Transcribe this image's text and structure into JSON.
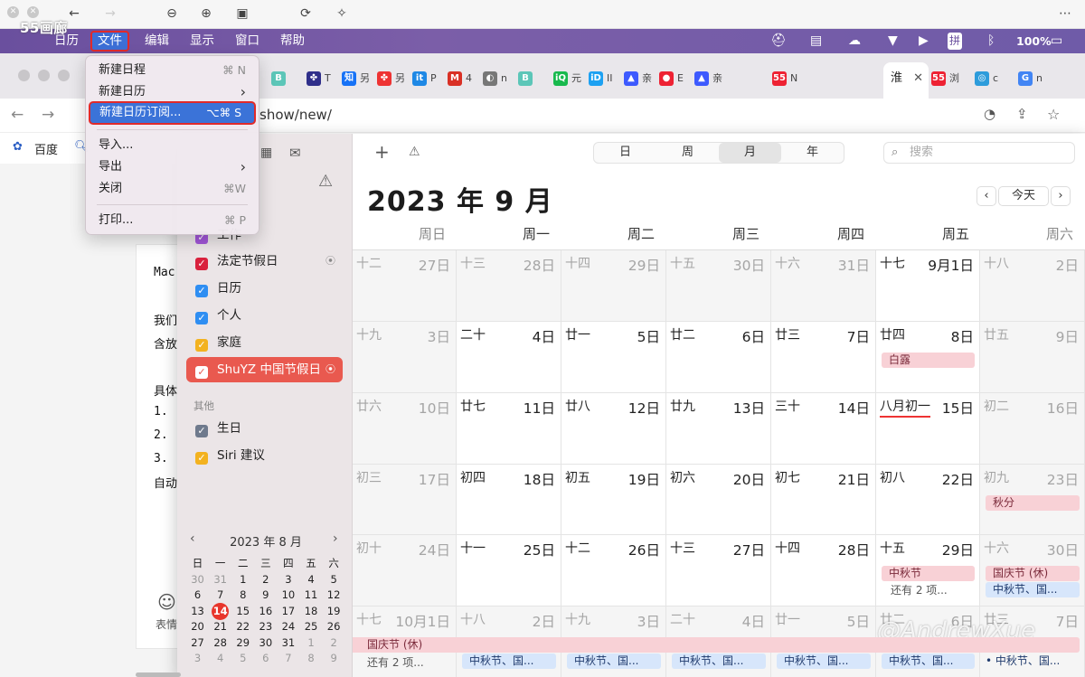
{
  "viewer": {
    "watermark_top": "55画廊"
  },
  "menubar": {
    "apple": "",
    "items": [
      "日历",
      "文件",
      "编辑",
      "显示",
      "窗口",
      "帮助"
    ],
    "battery": "100%",
    "input_method": "拼"
  },
  "browser": {
    "address": "show/new/",
    "bookmarks": [
      "百度"
    ],
    "tab_active_label": "淮",
    "tabs": [
      {
        "icon": "B",
        "label": "",
        "color": "#5cc6b8"
      },
      {
        "icon": "✤",
        "label": "T",
        "color": "#2f2f8a"
      },
      {
        "icon": "知",
        "label": "另",
        "color": "#1772f6"
      },
      {
        "icon": "✤",
        "label": "另",
        "color": "#e33"
      },
      {
        "icon": "it",
        "label": "P",
        "color": "#1e88e5"
      },
      {
        "icon": "M",
        "label": "4",
        "color": "#d93025"
      },
      {
        "icon": "◐",
        "label": "n",
        "color": "#777"
      },
      {
        "icon": "B",
        "label": "",
        "color": "#5cc6b8"
      },
      {
        "icon": "iQ",
        "label": "元",
        "color": "#18b94d"
      },
      {
        "icon": "iD",
        "label": "II",
        "color": "#1da1f2"
      },
      {
        "icon": "▲",
        "label": "亲",
        "color": "#3d5afe"
      },
      {
        "icon": "●",
        "label": "E",
        "color": "#e23"
      },
      {
        "icon": "▲",
        "label": "亲",
        "color": "#3d5afe"
      },
      {
        "icon": "55",
        "label": "N",
        "color": "#e23"
      },
      {
        "icon": "55",
        "label": "浏",
        "color": "#e23"
      },
      {
        "icon": "◎",
        "label": "c",
        "color": "#2d9cdb"
      },
      {
        "icon": "G",
        "label": "n",
        "color": "#4285f4"
      }
    ]
  },
  "page": {
    "lines": [
      "Mac",
      "我们",
      "含放",
      "具体",
      "1.",
      "2.",
      "3.",
      "自动"
    ],
    "emoji_label": "表情"
  },
  "file_menu": {
    "items": [
      {
        "label": "新建日程",
        "shortcut": "⌘ N"
      },
      {
        "label": "新建日历",
        "shortcut": "›"
      },
      {
        "label": "新建日历订阅...",
        "shortcut": "⌥⌘ S",
        "highlighted": true
      },
      {
        "label": "导入...",
        "shortcut": ""
      },
      {
        "label": "导出",
        "shortcut": "›"
      },
      {
        "label": "关闭",
        "shortcut": "⌘W"
      },
      {
        "label": "打印...",
        "shortcut": "⌘ P"
      }
    ]
  },
  "sidebar": {
    "calendars": [
      {
        "label": "工作",
        "color": "#a256d8"
      },
      {
        "label": "法定节假日",
        "color": "#d9213d",
        "broadcast": true
      },
      {
        "label": "日历",
        "color": "#2f8ef2"
      },
      {
        "label": "个人",
        "color": "#2f8ef2"
      },
      {
        "label": "家庭",
        "color": "#f3b21f"
      },
      {
        "label": "ShuYZ 中国节假日",
        "color": "#e9594f",
        "selected": true,
        "broadcast": true
      }
    ],
    "other_header": "其他",
    "others": [
      {
        "label": "生日",
        "color": "#6f7a8d"
      },
      {
        "label": "Siri 建议",
        "color": "#f3b21f"
      }
    ]
  },
  "mini_cal": {
    "title": "2023 年 8 月",
    "weekdays": [
      "日",
      "一",
      "二",
      "三",
      "四",
      "五",
      "六"
    ],
    "weeks": [
      [
        "30",
        "31",
        "1",
        "2",
        "3",
        "4",
        "5"
      ],
      [
        "6",
        "7",
        "8",
        "9",
        "10",
        "11",
        "12"
      ],
      [
        "13",
        "14",
        "15",
        "16",
        "17",
        "18",
        "19"
      ],
      [
        "20",
        "21",
        "22",
        "23",
        "24",
        "25",
        "26"
      ],
      [
        "27",
        "28",
        "29",
        "30",
        "31",
        "1",
        "2"
      ],
      [
        "3",
        "4",
        "5",
        "6",
        "7",
        "8",
        "9"
      ]
    ],
    "today": "14"
  },
  "toolbar": {
    "add": "+",
    "views": [
      "日",
      "周",
      "月",
      "年"
    ],
    "active_view": "月",
    "search_placeholder": "搜索",
    "today": "今天"
  },
  "calendar": {
    "title": "2023 年 9 月",
    "weekdays": [
      "周日",
      "周一",
      "周二",
      "周三",
      "周四",
      "周五",
      "周六"
    ],
    "weeks": [
      [
        {
          "lunar": "十二",
          "day": "27日",
          "grey": true
        },
        {
          "lunar": "十三",
          "day": "28日",
          "grey": true
        },
        {
          "lunar": "十四",
          "day": "29日",
          "grey": true
        },
        {
          "lunar": "十五",
          "day": "30日",
          "grey": true
        },
        {
          "lunar": "十六",
          "day": "31日",
          "grey": true
        },
        {
          "lunar": "十七",
          "day": "9月1日"
        },
        {
          "lunar": "十八",
          "day": "2日",
          "grey": true
        }
      ],
      [
        {
          "lunar": "十九",
          "day": "3日",
          "grey": true
        },
        {
          "lunar": "二十",
          "day": "4日"
        },
        {
          "lunar": "廿一",
          "day": "5日"
        },
        {
          "lunar": "廿二",
          "day": "6日"
        },
        {
          "lunar": "廿三",
          "day": "7日"
        },
        {
          "lunar": "廿四",
          "day": "8日",
          "events": [
            {
              "label": "白露",
              "color": "pink"
            }
          ]
        },
        {
          "lunar": "廿五",
          "day": "9日",
          "grey": true
        }
      ],
      [
        {
          "lunar": "廿六",
          "day": "10日",
          "grey": true
        },
        {
          "lunar": "廿七",
          "day": "11日"
        },
        {
          "lunar": "廿八",
          "day": "12日"
        },
        {
          "lunar": "廿九",
          "day": "13日"
        },
        {
          "lunar": "三十",
          "day": "14日"
        },
        {
          "lunar": "八月初一",
          "day": "15日",
          "underline": true
        },
        {
          "lunar": "初二",
          "day": "16日",
          "grey": true
        }
      ],
      [
        {
          "lunar": "初三",
          "day": "17日",
          "grey": true
        },
        {
          "lunar": "初四",
          "day": "18日"
        },
        {
          "lunar": "初五",
          "day": "19日"
        },
        {
          "lunar": "初六",
          "day": "20日"
        },
        {
          "lunar": "初七",
          "day": "21日"
        },
        {
          "lunar": "初八",
          "day": "22日"
        },
        {
          "lunar": "初九",
          "day": "23日",
          "grey": true,
          "events": [
            {
              "label": "秋分",
              "color": "pink"
            }
          ]
        }
      ],
      [
        {
          "lunar": "初十",
          "day": "24日",
          "grey": true
        },
        {
          "lunar": "十一",
          "day": "25日"
        },
        {
          "lunar": "十二",
          "day": "26日"
        },
        {
          "lunar": "十三",
          "day": "27日"
        },
        {
          "lunar": "十四",
          "day": "28日"
        },
        {
          "lunar": "十五",
          "day": "29日",
          "events": [
            {
              "label": "中秋节",
              "color": "pink"
            }
          ],
          "more": "还有 2 项..."
        },
        {
          "lunar": "十六",
          "day": "30日",
          "grey": true,
          "events": [
            {
              "label": "国庆节 (休)",
              "color": "pink"
            },
            {
              "label": "中秋节、国...",
              "color": "blue"
            }
          ]
        }
      ],
      [
        {
          "lunar": "十七",
          "day": "10月1日",
          "grey": true,
          "events": [
            {
              "label": "国庆节 (休)",
              "color": "pink",
              "span": true
            }
          ],
          "more": "还有 2 项..."
        },
        {
          "lunar": "十八",
          "day": "2日",
          "grey": true,
          "events": [
            {
              "label": "中秋节、国...",
              "color": "blue",
              "row": 2
            }
          ]
        },
        {
          "lunar": "十九",
          "day": "3日",
          "grey": true,
          "events": [
            {
              "label": "中秋节、国...",
              "color": "blue",
              "row": 2
            }
          ]
        },
        {
          "lunar": "二十",
          "day": "4日",
          "grey": true,
          "events": [
            {
              "label": "中秋节、国...",
              "color": "blue",
              "row": 2
            }
          ]
        },
        {
          "lunar": "廿一",
          "day": "5日",
          "grey": true,
          "events": [
            {
              "label": "中秋节、国...",
              "color": "blue",
              "row": 2
            }
          ]
        },
        {
          "lunar": "廿二",
          "day": "6日",
          "grey": true,
          "events": [
            {
              "label": "中秋节、国...",
              "color": "blue",
              "row": 2
            }
          ]
        },
        {
          "lunar": "廿三",
          "day": "7日",
          "grey": true,
          "events": [
            {
              "label": "国庆节 (班)",
              "color": "pink"
            },
            {
              "label": "中秋节、国...",
              "color": "blue",
              "dot": true
            }
          ]
        }
      ]
    ]
  },
  "watermark": "@AndrewXue"
}
